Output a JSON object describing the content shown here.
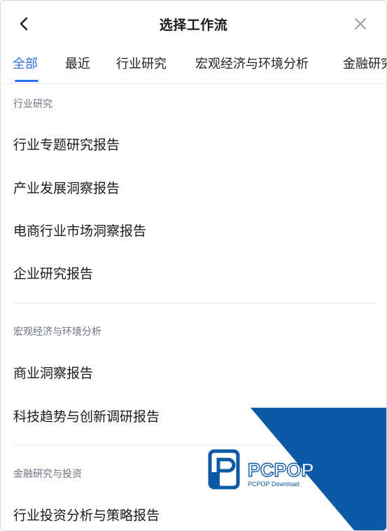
{
  "header": {
    "title": "选择工作流",
    "back_icon": "chevron-left-icon",
    "close_icon": "close-icon"
  },
  "tabs": [
    {
      "label": "全部",
      "active": true
    },
    {
      "label": "最近",
      "active": false
    },
    {
      "label": "行业研究",
      "active": false
    },
    {
      "label": "宏观经济与环境分析",
      "active": false
    },
    {
      "label": "金融研究",
      "active": false
    }
  ],
  "sections": [
    {
      "title": "行业研究",
      "items": [
        "行业专题研究报告",
        "产业发展洞察报告",
        "电商行业市场洞察报告",
        "企业研究报告"
      ]
    },
    {
      "title": "宏观经济与环境分析",
      "items": [
        "商业洞察报告",
        "科技趋势与创新调研报告"
      ]
    },
    {
      "title": "金融研究与投资",
      "items": [
        "行业投资分析与策略报告"
      ]
    }
  ],
  "watermark": {
    "brand": "PCPOP下载",
    "subtitle": "PCPOP Download"
  },
  "colors": {
    "accent": "#2e6fea",
    "section_header": "#6b7280",
    "watermark_blue": "#0c5aa6"
  }
}
